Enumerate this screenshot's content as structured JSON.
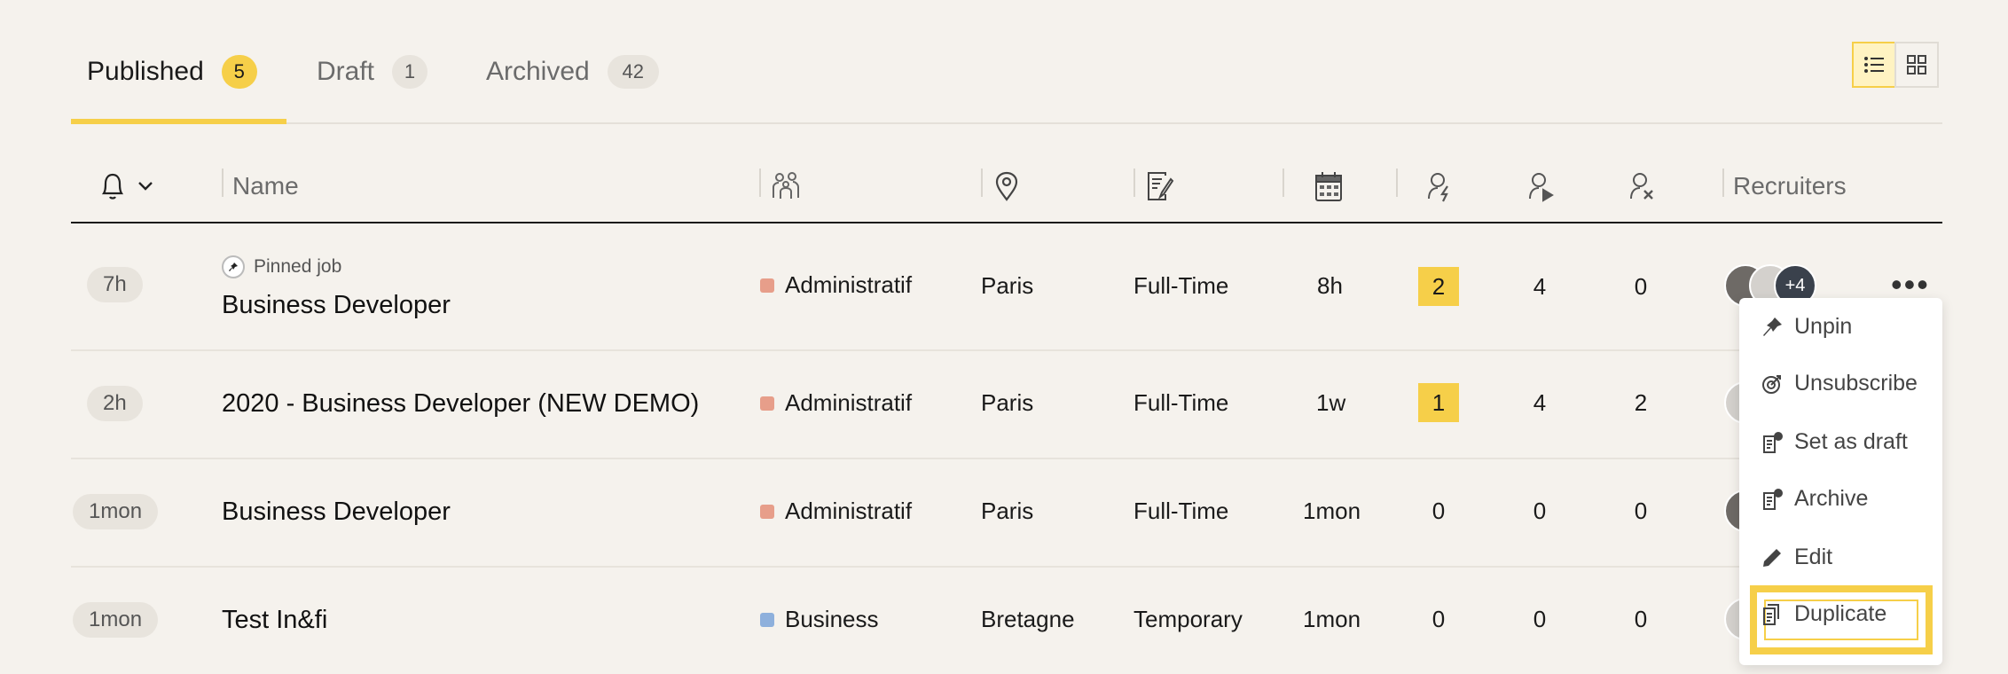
{
  "tabs": [
    {
      "label": "Published",
      "count": "5"
    },
    {
      "label": "Draft",
      "count": "1"
    },
    {
      "label": "Archived",
      "count": "42"
    }
  ],
  "view_toggle": {
    "list_icon": "list-view-icon",
    "grid_icon": "grid-view-icon",
    "active": "list"
  },
  "table": {
    "columns": {
      "alert_icon": "bell-icon",
      "name": "Name",
      "department_icon": "people-icon",
      "location_icon": "location-pin-icon",
      "contract_icon": "contract-edit-icon",
      "date_icon": "calendar-icon",
      "new_candidates_icon": "candidate-new-icon",
      "in_progress_icon": "candidate-play-icon",
      "rejected_icon": "candidate-x-icon",
      "recruiters": "Recruiters"
    },
    "rows": [
      {
        "age": "7h",
        "pinned_label": "Pinned job",
        "name": "Business Developer",
        "department": "Administratif",
        "dept_color": "#e79e8a",
        "location": "Paris",
        "contract": "Full-Time",
        "posted": "8h",
        "new": "2",
        "in_progress": "4",
        "rejected": "0",
        "more_recruiters": "+4"
      },
      {
        "age": "2h",
        "pinned_label": "",
        "name": "2020 - Business Developer (NEW DEMO)",
        "department": "Administratif",
        "dept_color": "#e79e8a",
        "location": "Paris",
        "contract": "Full-Time",
        "posted": "1w",
        "new": "1",
        "in_progress": "4",
        "rejected": "2",
        "more_recruiters": ""
      },
      {
        "age": "1mon",
        "pinned_label": "",
        "name": "Business Developer",
        "department": "Administratif",
        "dept_color": "#e79e8a",
        "location": "Paris",
        "contract": "Full-Time",
        "posted": "1mon",
        "new": "0",
        "in_progress": "0",
        "rejected": "0",
        "more_recruiters": ""
      },
      {
        "age": "1mon",
        "pinned_label": "",
        "name": "Test In&fi",
        "department": "Business",
        "dept_color": "#8eb0dc",
        "location": "Bretagne",
        "contract": "Temporary",
        "posted": "1mon",
        "new": "0",
        "in_progress": "0",
        "rejected": "0",
        "more_recruiters": ""
      }
    ]
  },
  "row_menu": {
    "items": [
      {
        "label": "Unpin",
        "icon": "pin-icon"
      },
      {
        "label": "Unsubscribe",
        "icon": "unsubscribe-icon"
      },
      {
        "label": "Set as draft",
        "icon": "draft-icon"
      },
      {
        "label": "Archive",
        "icon": "archive-icon"
      },
      {
        "label": "Edit",
        "icon": "pencil-icon"
      },
      {
        "label": "Duplicate",
        "icon": "duplicate-icon"
      }
    ],
    "highlighted": "Duplicate"
  },
  "colors": {
    "accent": "#f6cf49",
    "background": "#f5f2ed"
  }
}
